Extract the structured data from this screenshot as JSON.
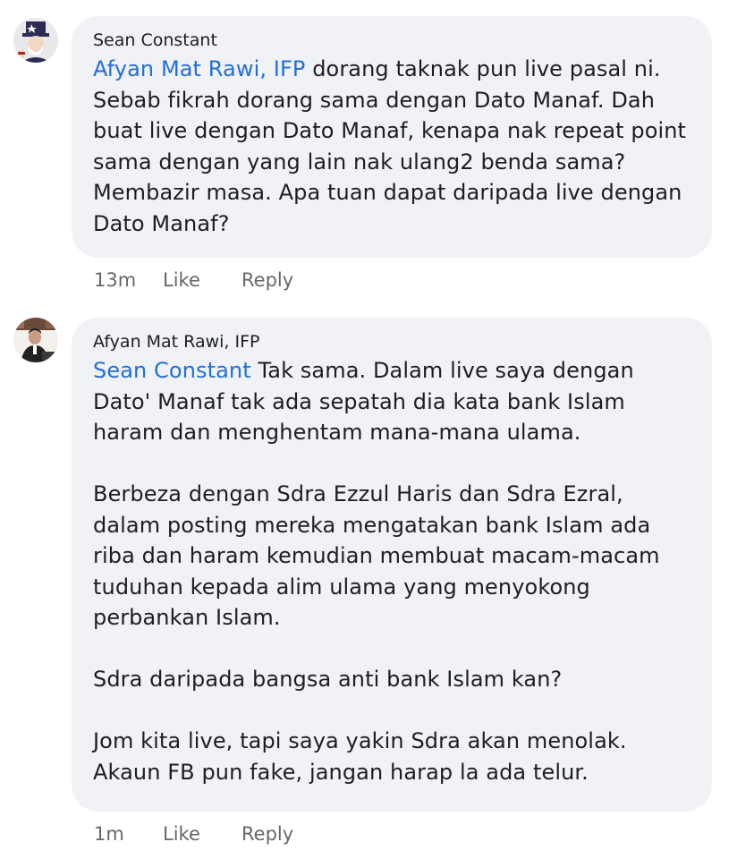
{
  "comments": [
    {
      "author": "Sean Constant",
      "avatar_icon": "uncle-sam-avatar-icon",
      "mention": "Afyan Mat Rawi, IFP",
      "text": " dorang taknak pun live pasal ni. Sebab fikrah dorang sama dengan Dato Manaf. Dah buat live dengan Dato Manaf, kenapa nak repeat point sama dengan yang lain nak ulang2 benda sama? Membazir masa. Apa tuan dapat daripada live dengan Dato Manaf?",
      "time": "13m",
      "like_label": "Like",
      "reply_label": "Reply"
    },
    {
      "author": "Afyan Mat Rawi, IFP",
      "avatar_icon": "person-avatar-icon",
      "mention": "Sean Constant",
      "paragraphs": [
        " Tak sama. Dalam live saya dengan Dato' Manaf tak ada sepatah dia kata bank Islam haram dan menghentam mana-mana ulama.",
        "Berbeza dengan Sdra Ezzul Haris dan Sdra Ezral, dalam posting mereka mengatakan bank Islam ada riba dan haram kemudian membuat macam-macam tuduhan kepada alim ulama yang menyokong perbankan Islam.",
        "Sdra daripada bangsa anti bank Islam kan?",
        "Jom kita live, tapi saya yakin Sdra akan menolak. Akaun FB pun fake, jangan harap la ada telur."
      ],
      "time": "1m",
      "like_label": "Like",
      "reply_label": "Reply"
    }
  ],
  "colors": {
    "bubble": "#f0f2f5",
    "mention": "#216fdb",
    "meta": "#65676b",
    "text": "#1c1e21"
  }
}
